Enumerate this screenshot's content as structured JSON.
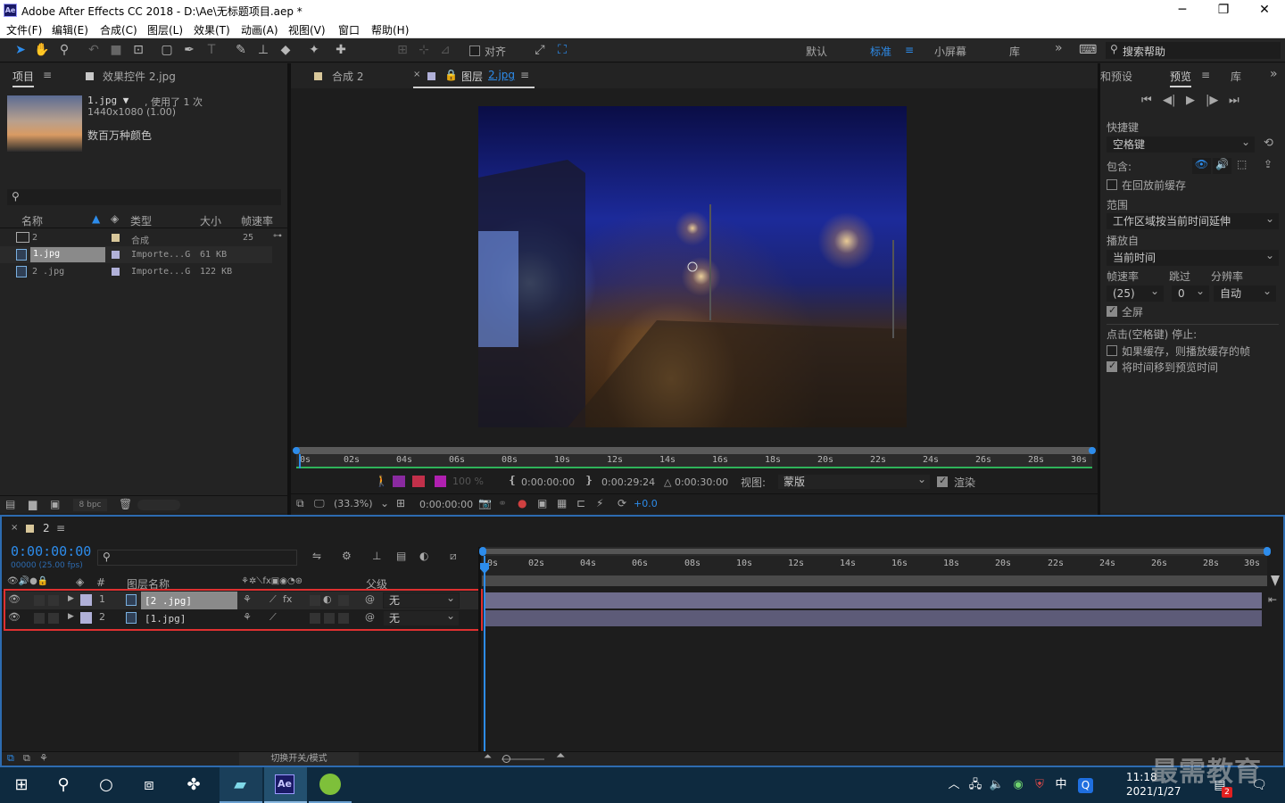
{
  "window": {
    "title": "Adobe After Effects CC 2018 - D:\\Ae\\无标题项目.aep *",
    "app_icon": "Ae",
    "minimize": "─",
    "maximize": "❐",
    "close": "✕"
  },
  "menu": [
    "文件(F)",
    "编辑(E)",
    "合成(C)",
    "图层(L)",
    "效果(T)",
    "动画(A)",
    "视图(V)",
    "窗口",
    "帮助(H)"
  ],
  "toolbar": {
    "snap_label": "对齐",
    "workspaces": [
      "默认",
      "标准",
      "小屏幕",
      "库"
    ],
    "active_workspace": "标准",
    "search_placeholder": "搜索帮助",
    "more": "»"
  },
  "project_panel": {
    "tab_project": "项目",
    "tab_effects": "效果控件 2.jpg",
    "selected_name": "1.jpg ▼",
    "usage": ", 使用了 1 次",
    "dims": "1440x1080 (1.00)",
    "colors": "数百万种颜色",
    "columns": [
      "名称",
      "类型",
      "大小",
      "帧速率"
    ],
    "rows": [
      {
        "name": "2",
        "type": "合成",
        "size": "",
        "fps": "25"
      },
      {
        "name": "1.jpg",
        "type": "Importe...G",
        "size": "61 KB",
        "fps": ""
      },
      {
        "name": "2 .jpg",
        "type": "Importe...G",
        "size": "122 KB",
        "fps": ""
      }
    ],
    "bpc": "8 bpc"
  },
  "viewer": {
    "tab_comp": "合成 2",
    "tab_layer_prefix": "图层",
    "tab_layer_name": "2.jpg",
    "ruler_ticks": [
      "0s",
      "02s",
      "04s",
      "06s",
      "08s",
      "10s",
      "12s",
      "14s",
      "16s",
      "18s",
      "20s",
      "22s",
      "24s",
      "26s",
      "28s",
      "30s"
    ],
    "opacity": "100 %",
    "in_time": "0:00:00:00",
    "out_time": "0:00:29:24",
    "dur_time": "△ 0:00:30:00",
    "view_label": "视图:",
    "view_value": "蒙版",
    "render_label": "渲染",
    "zoom": "(33.3%)",
    "timecode": "0:00:00:00",
    "exposure": "+0.0"
  },
  "preview_panel": {
    "tab_presets": "和预设",
    "tab_preview": "预览",
    "tab_lib": "库",
    "shortcut_label": "快捷键",
    "shortcut_value": "空格键",
    "include_label": "包含:",
    "cache_label": "在回放前缓存",
    "range_label": "范围",
    "range_value": "工作区域按当前时间延伸",
    "play_from_label": "播放自",
    "play_from_value": "当前时间",
    "fps_label": "帧速率",
    "skip_label": "跳过",
    "res_label": "分辨率",
    "fps_value": "(25)",
    "skip_value": "0",
    "res_value": "自动",
    "fullscreen_label": "全屏",
    "stop_label": "点击(空格键) 停止:",
    "if_cache_label": "如果缓存，则播放缓存的帧",
    "move_time_label": "将时间移到预览时间"
  },
  "timeline": {
    "tab_name": "2",
    "timecode": "0:00:00:00",
    "fps_info": "00000 (25.00 fps)",
    "col_hash": "#",
    "col_layername": "图层名称",
    "col_parent": "父级",
    "layers": [
      {
        "num": "1",
        "name": "[2 .jpg]",
        "parent": "无"
      },
      {
        "num": "2",
        "name": "[1.jpg]",
        "parent": "无"
      }
    ],
    "ruler_ticks": [
      "0s",
      "02s",
      "04s",
      "06s",
      "08s",
      "10s",
      "12s",
      "14s",
      "16s",
      "18s",
      "20s",
      "22s",
      "24s",
      "26s",
      "28s",
      "30s"
    ],
    "mode_toggle": "切换开关/模式"
  },
  "taskbar": {
    "ime": "中",
    "time": "11:18",
    "date": "2021/1/27",
    "notif_count": "2",
    "watermark": "最需教育"
  }
}
